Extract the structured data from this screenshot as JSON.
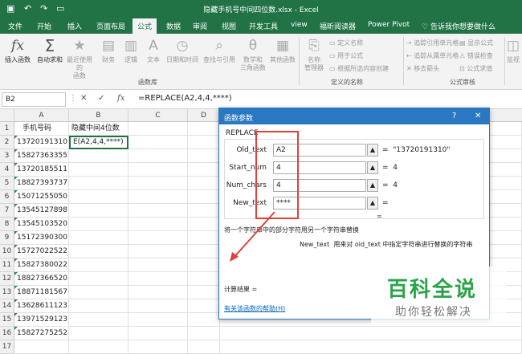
{
  "window": {
    "title": "隐藏手机号中间四位数.xlsx - Excel",
    "qa_undo": "↶",
    "qa_redo": "↷",
    "qa_save": "▭"
  },
  "tabs": [
    "文件",
    "开始",
    "插入",
    "页面布局",
    "公式",
    "数据",
    "审阅",
    "视图",
    "开发工具",
    "view",
    "福昕阅读器",
    "Power Pivot"
  ],
  "active_tab": "公式",
  "tell_me": "告诉我你想要做什么",
  "ribbon": {
    "insert_function": "插入函数",
    "autosum": "自动求和",
    "recent": "最近使用的",
    "recent2": "函数",
    "financial": "财务",
    "logical": "逻辑",
    "text": "文本",
    "datetime": "日期和时间",
    "lookup": "查找与引用",
    "math": "数学和",
    "math2": "三角函数",
    "more": "其他函数",
    "group_library": "函数库",
    "name_manager": "名称",
    "name_manager2": "管理器",
    "define_name": "定义名称",
    "use_in_formula": "用于公式",
    "create_from_sel": "根据所选内容创建",
    "group_names": "定义的名称",
    "trace_precedents": "追踪引用单元格",
    "trace_dependents": "追踪从属单元格",
    "remove_arrows": "移去箭头",
    "show_formulas": "显示公式",
    "error_check": "错误检查",
    "evaluate": "公式求值",
    "group_audit": "公式审核",
    "watch": "监视"
  },
  "formula_bar": {
    "name_box": "B2",
    "cancel": "✕",
    "enter": "✓",
    "fx": "fx",
    "formula": "=REPLACE(A2,4,4,****)"
  },
  "grid": {
    "columns": [
      "A",
      "B",
      "C",
      "D"
    ],
    "header_a": "手机号码",
    "header_b": "隐藏中间4位数",
    "editing_cell": "E(A2,4,4,****)",
    "rows": [
      "1",
      "2",
      "3",
      "4",
      "5",
      "6",
      "7",
      "8",
      "9",
      "10",
      "11",
      "12",
      "13",
      "14",
      "15",
      "16",
      "17"
    ],
    "phones": [
      "13720191310",
      "15827363355",
      "13720185511",
      "18827393737",
      "15071255050",
      "13545127898",
      "13545103520",
      "15172390300",
      "15727022522",
      "15827380022",
      "18827366520",
      "18871181567",
      "13628611123",
      "13971529123",
      "15827275252"
    ]
  },
  "dialog": {
    "title": "函数参数",
    "help_btn": "?",
    "close_btn": "✕",
    "function_name": "REPLACE",
    "args": [
      {
        "label": "Old_text",
        "value": "A2",
        "result": "\"13720191310\""
      },
      {
        "label": "Start_num",
        "value": "4",
        "result": "4"
      },
      {
        "label": "Num_chars",
        "value": "4",
        "result": "4"
      },
      {
        "label": "New_text",
        "value": "****",
        "result": ""
      }
    ],
    "eq": "=",
    "description": "将一个字符串中的部分字符用另一个字符串替换",
    "arg_help_name": "New_text",
    "arg_help": "用来对 old_text 中指定字符串进行替换的字符串",
    "calc_result": "计算结果 =",
    "help_link": "有关该函数的帮助(H)"
  },
  "watermark": {
    "line1": "百科全说",
    "line2": "助你轻松解决"
  },
  "colors": {
    "excel_green": "#217346",
    "dialog_blue": "#2b78c2",
    "highlight_red": "#e0403a",
    "watermark_green": "#2aa34a"
  }
}
